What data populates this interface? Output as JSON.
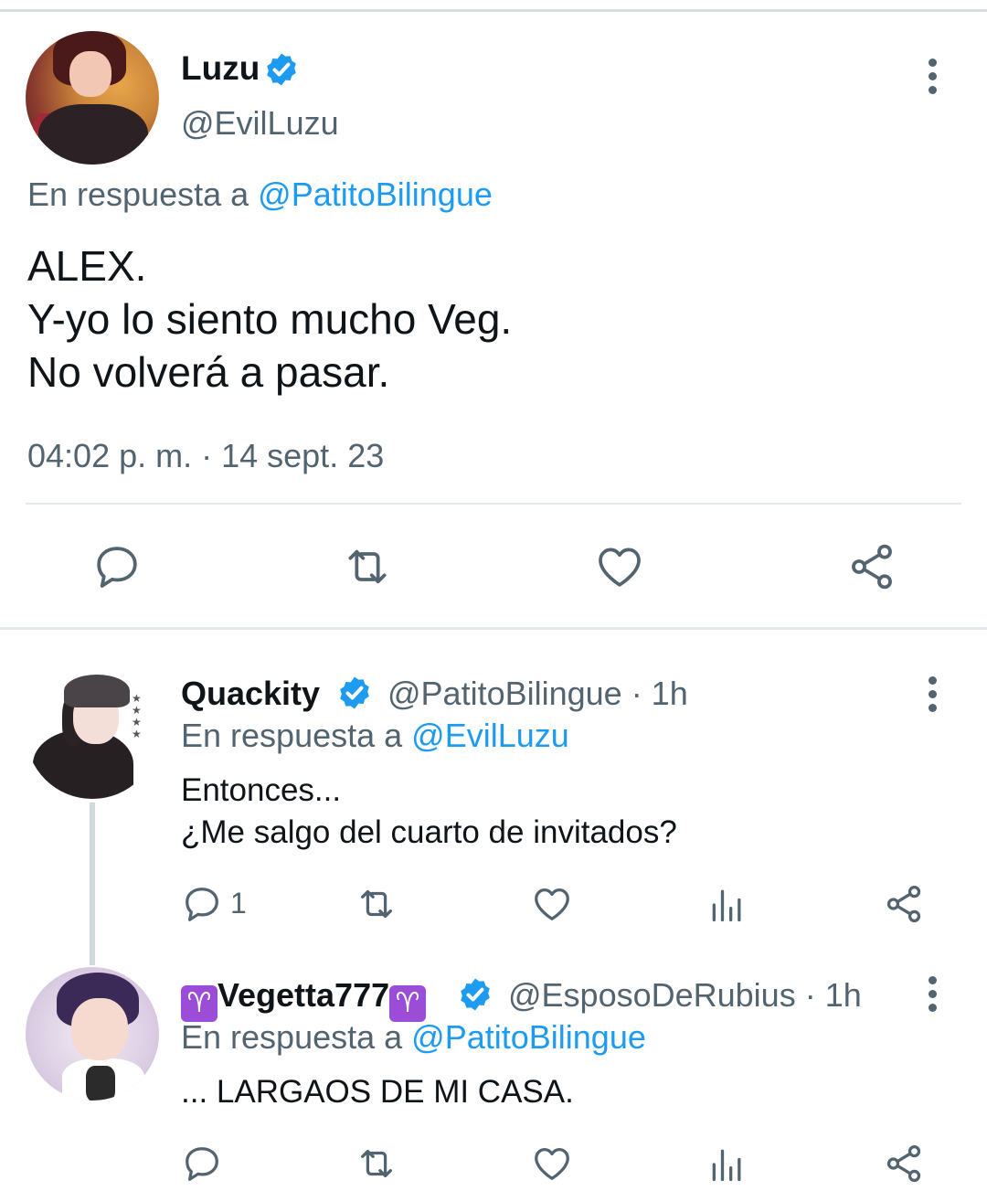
{
  "main_tweet": {
    "name": "Luzu",
    "handle": "@EvilLuzu",
    "reply_prefix": "En respuesta a ",
    "reply_to": "@PatitoBilingue",
    "text_lines": [
      "ALEX.",
      "Y-yo lo siento mucho Veg.",
      "No volverá a pasar."
    ],
    "timestamp": "04:02 p. m. · 14 sept. 23",
    "actions": [
      "reply-icon",
      "retweet-icon",
      "like-icon",
      "share-icon"
    ]
  },
  "replies": [
    {
      "name": "Quackity",
      "handle_time": "@PatitoBilingue · 1h",
      "reply_prefix": "En respuesta a ",
      "reply_to": "@EvilLuzu",
      "text_lines": [
        "Entonces...",
        "¿Me salgo del cuarto de invitados?"
      ],
      "reply_count": "1"
    },
    {
      "name_prefix_symbol": "♈",
      "name": "Vegetta777",
      "name_suffix_symbol": "♈",
      "handle_time": "@EsposoDeRubius · 1h",
      "reply_prefix": "En respuesta a ",
      "reply_to": "@PatitoBilingue",
      "text_lines": [
        "... LARGAOS DE MI CASA."
      ],
      "reply_count": ""
    }
  ],
  "colors": {
    "text": "#0f1419",
    "secondary": "#536471",
    "link": "#1d9bf0",
    "verified": "#1d9bf0"
  }
}
